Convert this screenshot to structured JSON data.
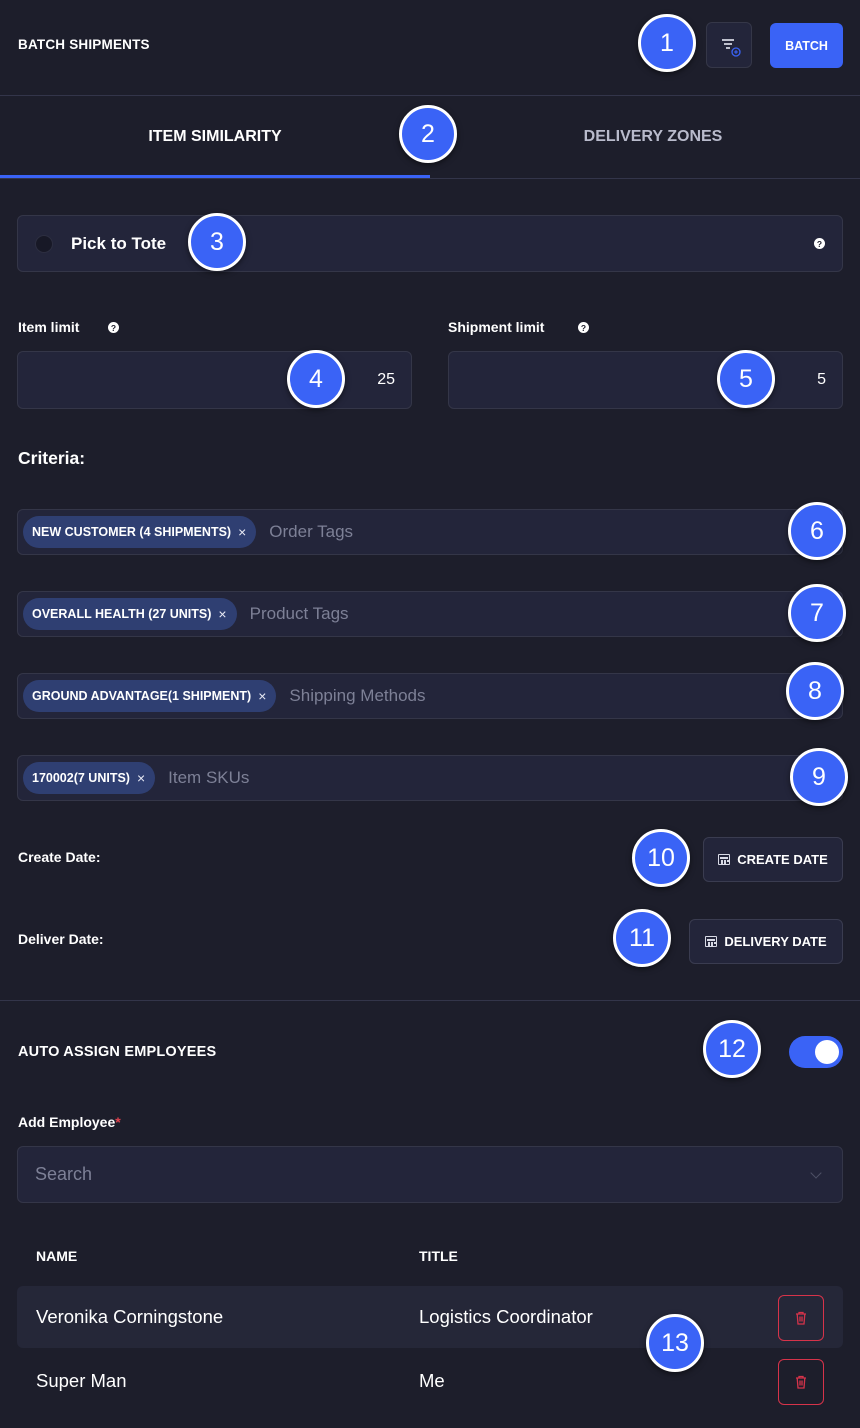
{
  "header": {
    "title": "BATCH SHIPMENTS",
    "batch_label": "BATCH"
  },
  "tabs": [
    {
      "label": "ITEM SIMILARITY",
      "active": true
    },
    {
      "label": "DELIVERY ZONES",
      "active": false
    }
  ],
  "pick_to_tote": {
    "label": "Pick to Tote",
    "checked": false,
    "help": "?"
  },
  "limits": {
    "item": {
      "label": "Item limit",
      "value": "25",
      "help": "?"
    },
    "shipment": {
      "label": "Shipment limit",
      "value": "5",
      "help": "?"
    }
  },
  "criteria": {
    "title": "Criteria:",
    "fields": [
      {
        "chip": "NEW CUSTOMER (4 SHIPMENTS)",
        "remove": "×",
        "placeholder": "Order Tags"
      },
      {
        "chip": "OVERALL HEALTH (27 UNITS)",
        "remove": "×",
        "placeholder": "Product Tags"
      },
      {
        "chip": "GROUND ADVANTAGE(1 SHIPMENT)",
        "remove": "×",
        "placeholder": "Shipping Methods"
      },
      {
        "chip": "170002(7 UNITS)",
        "remove": "×",
        "placeholder": "Item SKUs"
      }
    ]
  },
  "dates": {
    "create": {
      "label": "Create Date:",
      "button": "CREATE DATE"
    },
    "deliver": {
      "label": "Deliver Date:",
      "button": "DELIVERY DATE"
    }
  },
  "auto_assign": {
    "title": "AUTO ASSIGN EMPLOYEES",
    "enabled": true,
    "add_label": "Add Employee",
    "required_mark": "*",
    "search_placeholder": "Search"
  },
  "employees_table": {
    "columns": [
      "NAME",
      "TITLE"
    ],
    "rows": [
      {
        "name": "Veronika Corningstone",
        "title": "Logistics Coordinator"
      },
      {
        "name": "Super Man",
        "title": "Me"
      }
    ]
  },
  "markers": [
    "1",
    "2",
    "3",
    "4",
    "5",
    "6",
    "7",
    "8",
    "9",
    "10",
    "11",
    "12",
    "13"
  ],
  "colors": {
    "background": "#1d1e2b",
    "panel": "#23253a",
    "accent": "#3a63f6",
    "danger": "#d6334a",
    "chip": "#2f3f72"
  }
}
